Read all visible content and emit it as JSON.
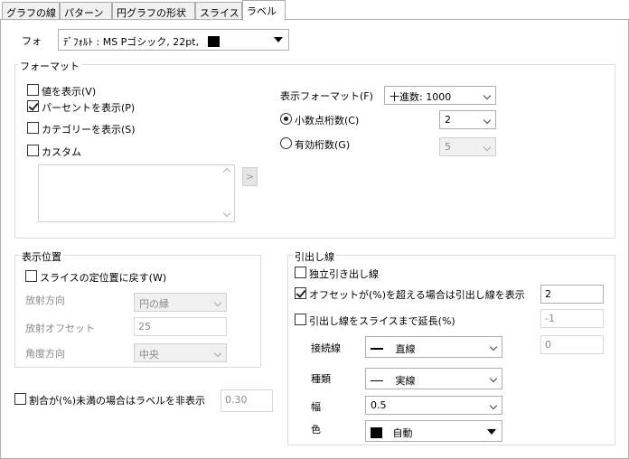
{
  "tabs": [
    {
      "label": "グラフの線"
    },
    {
      "label": "パターン"
    },
    {
      "label": "円グラフの形状"
    },
    {
      "label": "スライス"
    },
    {
      "label": "ラベル"
    }
  ],
  "font": {
    "label": "フォ",
    "value": "ﾃﾞﾌｫﾙﾄ : MS Pゴシック, 22pt,",
    "color": "#000000"
  },
  "format": {
    "legend": "フォーマット",
    "show_value": {
      "label": "値を表示(V)",
      "checked": false
    },
    "show_percent": {
      "label": "パーセントを表示(P)",
      "checked": true
    },
    "show_category": {
      "label": "カテゴリーを表示(S)",
      "checked": false
    },
    "custom": {
      "label": "カスタム",
      "checked": false
    },
    "custom_text": "",
    "insert_button": ">",
    "display_format": {
      "label": "表示フォーマット(F)",
      "value": "十進数: 1000"
    },
    "decimal_places": {
      "label": "小数点桁数(C)",
      "value": "2",
      "selected": true
    },
    "significant_digits": {
      "label": "有効桁数(G)",
      "value": "5",
      "selected": false
    }
  },
  "position": {
    "legend": "表示位置",
    "reset": {
      "label": "スライスの定位置に戻す(W)",
      "checked": false
    },
    "radial_direction": {
      "label": "放射方向",
      "value": "円の縁"
    },
    "radial_offset": {
      "label": "放射オフセット",
      "value": "25"
    },
    "angle_direction": {
      "label": "角度方向",
      "value": "中央"
    }
  },
  "hide_below": {
    "label": "割合が(%)未満の場合はラベルを非表示",
    "checked": false,
    "value": "0.30"
  },
  "leader": {
    "legend": "引出し線",
    "independent": {
      "label": "独立引き出し線",
      "checked": false
    },
    "offset_show": {
      "label": "オフセットが(%)を超える場合は引出し線を表示",
      "checked": true,
      "value": "2"
    },
    "extend": {
      "label": "引出し線をスライスまで延長(%)",
      "checked": false,
      "value": "-1"
    },
    "connector": {
      "label": "接続線",
      "value": "直線",
      "extra": "0"
    },
    "type": {
      "label": "種類",
      "value": "実線"
    },
    "width": {
      "label": "幅",
      "value": "0.5"
    },
    "color": {
      "label": "色",
      "value": "自動",
      "swatch": "#000000"
    }
  }
}
